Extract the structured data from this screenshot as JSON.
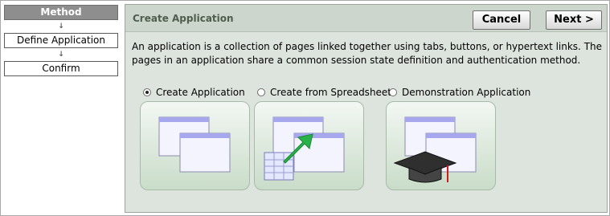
{
  "wizard": {
    "steps": [
      {
        "label": "Method",
        "active": true
      },
      {
        "label": "Define Application",
        "active": false
      },
      {
        "label": "Confirm",
        "active": false
      }
    ]
  },
  "panel": {
    "title": "Create Application",
    "cancel_label": "Cancel",
    "next_label": "Next >",
    "description": "An application is a collection of pages linked together using tabs, buttons, or hypertext links. The pages in an application share a common session state definition and authentication method."
  },
  "options": [
    {
      "label": "Create Application",
      "selected": true,
      "icon": "application-windows-icon"
    },
    {
      "label": "Create from Spreadsheet",
      "selected": false,
      "icon": "spreadsheet-import-icon"
    },
    {
      "label": "Demonstration Application",
      "selected": false,
      "icon": "graduation-cap-icon"
    }
  ],
  "colors": {
    "panel_bg": "#dde4dd",
    "header_bg": "#ccd6cc",
    "active_step": "#8e8e8e",
    "window_title": "#a7a7ee",
    "arrow_green": "#2ab24a"
  }
}
